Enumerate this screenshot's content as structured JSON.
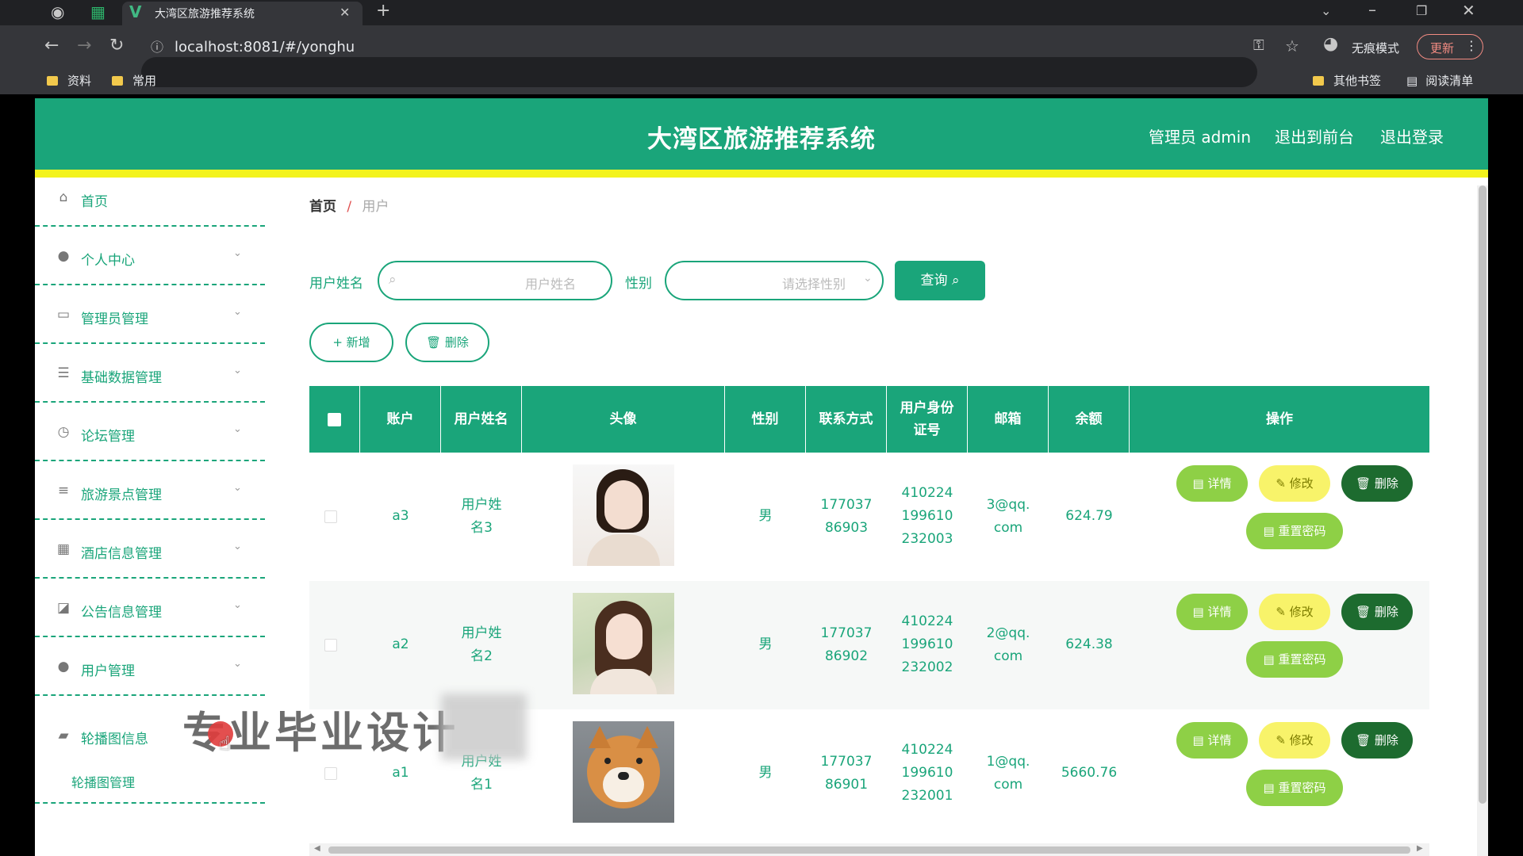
{
  "browser": {
    "tab_title": "大湾区旅游推荐系统",
    "url": "localhost:8081/#/yonghu",
    "incognito_label": "无痕模式",
    "update_label": "更新",
    "bookmarks": [
      "资料",
      "常用"
    ],
    "other_bookmarks": "其他书签",
    "reading_list": "阅读清单"
  },
  "header": {
    "title": "大湾区旅游推荐系统",
    "admin_label": "管理员 admin",
    "frontend_link": "退出到前台",
    "logout_link": "退出登录"
  },
  "sidebar": {
    "items": [
      {
        "label": "首页",
        "icon": "home-icon",
        "has_arrow": false
      },
      {
        "label": "个人中心",
        "icon": "user-icon",
        "has_arrow": true
      },
      {
        "label": "管理员管理",
        "icon": "card-icon",
        "has_arrow": true
      },
      {
        "label": "基础数据管理",
        "icon": "sliders-icon",
        "has_arrow": true
      },
      {
        "label": "论坛管理",
        "icon": "clock-icon",
        "has_arrow": true
      },
      {
        "label": "旅游景点管理",
        "icon": "list-icon",
        "has_arrow": true
      },
      {
        "label": "酒店信息管理",
        "icon": "grid-icon",
        "has_arrow": true
      },
      {
        "label": "公告信息管理",
        "icon": "chart-icon",
        "has_arrow": true
      },
      {
        "label": "用户管理",
        "icon": "user-icon",
        "has_arrow": true
      },
      {
        "label": "轮播图信息",
        "icon": "briefcase-icon",
        "has_arrow": false
      }
    ],
    "sub_item": "轮播图管理"
  },
  "breadcrumb": {
    "home": "首页",
    "separator": "/",
    "current": "用户"
  },
  "search": {
    "name_label": "用户姓名",
    "name_placeholder": "用户姓名",
    "gender_label": "性别",
    "gender_placeholder": "请选择性别",
    "query_button": "查询"
  },
  "actions": {
    "add": "新增",
    "delete": "删除"
  },
  "table": {
    "headers": [
      "账户",
      "用户姓名",
      "头像",
      "性别",
      "联系方式",
      "用户身份证号",
      "邮箱",
      "余额",
      "操作"
    ],
    "rows": [
      {
        "account": "a3",
        "name": "用户姓名3",
        "gender": "男",
        "phone": "17703786903",
        "id_card": "410224199610232003",
        "email": "3@qq.com",
        "balance": "624.79",
        "avatar": "avatar-woman-1"
      },
      {
        "account": "a2",
        "name": "用户姓名2",
        "gender": "男",
        "phone": "17703786902",
        "id_card": "410224199610232002",
        "email": "2@qq.com",
        "balance": "624.38",
        "avatar": "avatar-woman-2"
      },
      {
        "account": "a1",
        "name": "用户姓名1",
        "gender": "男",
        "phone": "17703786901",
        "id_card": "410224199610232001",
        "email": "1@qq.com",
        "balance": "5660.76",
        "avatar": "avatar-dog"
      }
    ],
    "row_actions": {
      "detail": "详情",
      "edit": "修改",
      "delete": "删除",
      "reset": "重置密码"
    }
  },
  "overlay": {
    "watermark": "专业毕业设计"
  },
  "colors": {
    "primary": "#1aa57a",
    "accent_band": "#f3f31d",
    "detail_btn": "#8ed046",
    "edit_btn": "#f8f36a",
    "delete_btn": "#1d6b2f"
  }
}
